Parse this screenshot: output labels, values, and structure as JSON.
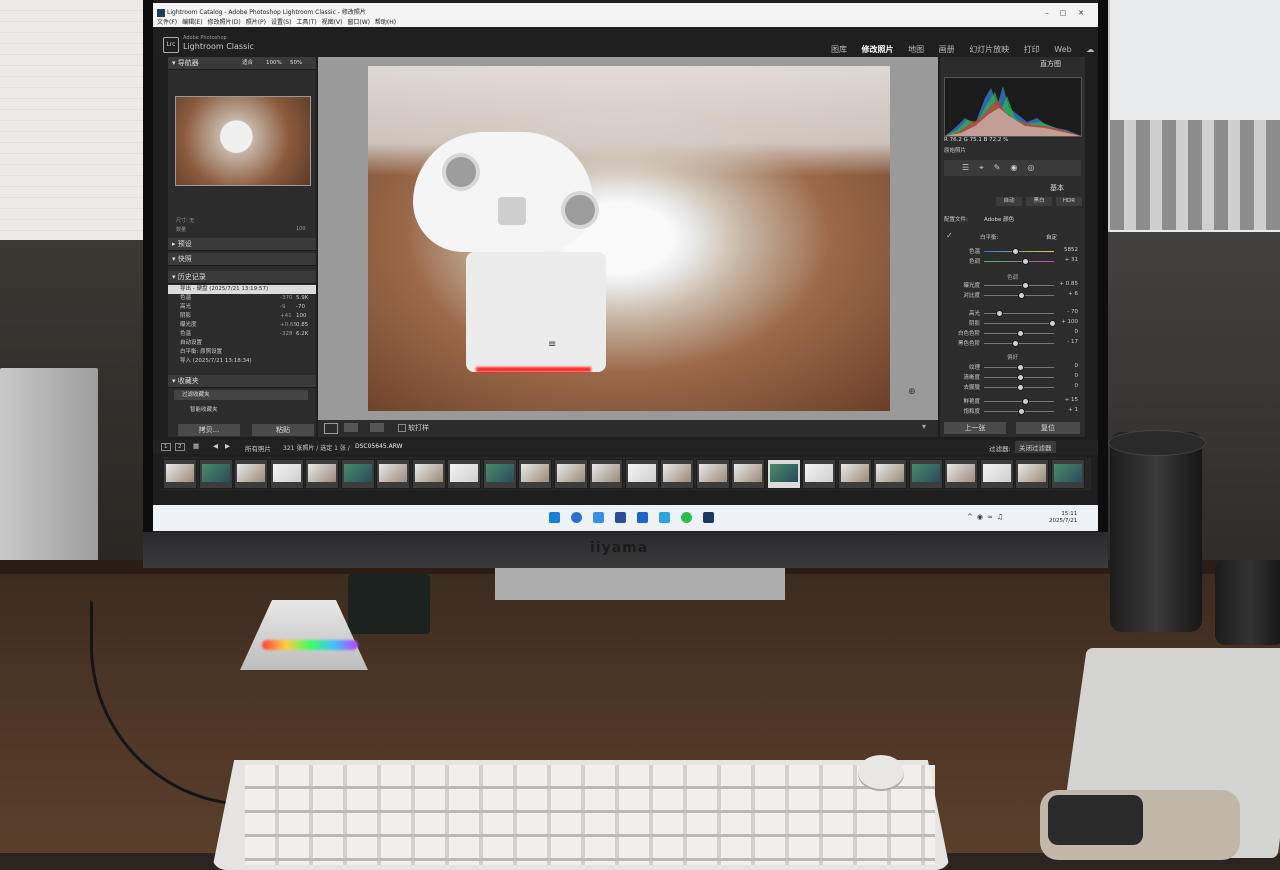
{
  "window": {
    "title": "Lightroom Catalog - Adobe Photoshop Lightroom Classic - 修改照片",
    "menus": [
      "文件(F)",
      "编辑(E)",
      "修改照片(D)",
      "照片(P)",
      "设置(S)",
      "工具(T)",
      "视图(V)",
      "窗口(W)",
      "帮助(H)"
    ]
  },
  "app": {
    "logo": "Lrc",
    "vendor": "Adobe Photoshop",
    "name": "Lightroom Classic",
    "modules": [
      "图库",
      "修改照片",
      "地图",
      "画册",
      "幻灯片放映",
      "打印",
      "Web"
    ],
    "active_module": "修改照片"
  },
  "left_panel": {
    "navigator": {
      "title": "导航器",
      "zoom_options": [
        "适合",
        "100%",
        "50%"
      ]
    },
    "size_label": "尺寸: 无",
    "amount_label": "数量",
    "amount_value": "100",
    "presets": "预设",
    "snapshots": "快照",
    "history": {
      "title": "历史记录",
      "items": [
        {
          "label": "导出 - 硬盘 (2025/7/21 13:19:57)",
          "v1": "",
          "v2": "",
          "selected": true
        },
        {
          "label": "色温",
          "v1": "-370",
          "v2": "5.9K",
          "selected": false
        },
        {
          "label": "高光",
          "v1": "-9",
          "v2": "-70",
          "selected": false
        },
        {
          "label": "阴影",
          "v1": "+41",
          "v2": "100",
          "selected": false
        },
        {
          "label": "曝光度",
          "v1": "+0.65",
          "v2": "0.85",
          "selected": false
        },
        {
          "label": "色温",
          "v1": "-328",
          "v2": "6.2K",
          "selected": false
        },
        {
          "label": "自动设置",
          "v1": "",
          "v2": "",
          "selected": false
        },
        {
          "label": "白平衡: 原照设置",
          "v1": "",
          "v2": "",
          "selected": false
        },
        {
          "label": "导入 (2025/7/21 13:18:34)",
          "v1": "",
          "v2": "",
          "selected": false
        }
      ]
    },
    "collections": {
      "title": "收藏夹",
      "filter": "过滤收藏夹",
      "smart": "智能收藏夹"
    },
    "copy_btn": "拷贝...",
    "paste_btn": "粘贴"
  },
  "toolbar": {
    "soft_proof": "软打样"
  },
  "right_panel": {
    "histogram_title": "直方图",
    "values": "R 76.2  G 75.1  B 72.2 %",
    "original_photo": "原始照片",
    "basic_title": "基本",
    "treatment": [
      "自动",
      "黑白",
      "HDR"
    ],
    "profile_label": "配置文件:",
    "profile_value": "Adobe 颜色",
    "wb_label": "白平衡:",
    "wb_value": "自定",
    "tone_label": "色调",
    "presence_label": "偏好",
    "sliders": [
      {
        "label": "色温",
        "value": "5852",
        "pos": 0.42
      },
      {
        "label": "色调",
        "value": "+ 31",
        "pos": 0.58
      },
      {
        "label": "曝光度",
        "value": "+ 0.85",
        "pos": 0.58
      },
      {
        "label": "对比度",
        "value": "+ 6",
        "pos": 0.52
      },
      {
        "label": "高光",
        "value": "- 70",
        "pos": 0.18
      },
      {
        "label": "阴影",
        "value": "+ 100",
        "pos": 0.98
      },
      {
        "label": "白色色阶",
        "value": "0",
        "pos": 0.5
      },
      {
        "label": "黑色色阶",
        "value": "- 17",
        "pos": 0.42
      },
      {
        "label": "纹理",
        "value": "0",
        "pos": 0.5
      },
      {
        "label": "清晰度",
        "value": "0",
        "pos": 0.5
      },
      {
        "label": "去朦胧",
        "value": "0",
        "pos": 0.5
      },
      {
        "label": "鲜艳度",
        "value": "+ 15",
        "pos": 0.57
      },
      {
        "label": "饱和度",
        "value": "+ 1",
        "pos": 0.51
      }
    ],
    "prev_btn": "上一张",
    "reset_btn": "复位"
  },
  "filmstrip": {
    "pages": [
      "1",
      "2"
    ],
    "source": "所有照片",
    "count_text": "321 张照片 / 选定 1 张 /",
    "filename": "DSC05645.ARW",
    "filter_label": "过滤器:",
    "filter_value": "关闭过滤器",
    "thumb_count": 26,
    "selected_index": 17
  },
  "taskbar": {
    "time": "15:11",
    "date": "2025/7/21"
  },
  "monitor_brand": "iiyama",
  "colors": {
    "lr_panel": "#2c2c2c",
    "lr_header": "#1f1f1f",
    "taskbar": "#eef1f6",
    "accent_led": "#ff2a2a"
  }
}
